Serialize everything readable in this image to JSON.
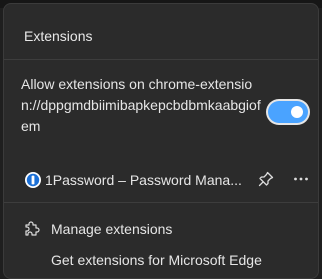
{
  "header": {
    "title": "Extensions"
  },
  "site_access": {
    "label": "Allow extensions on chrome-extension://dppgmdbiimibapkepcbdbmkaabgiofem",
    "enabled": true
  },
  "extensions": [
    {
      "name": "1Password – Password Mana...",
      "icon": "1password-icon"
    }
  ],
  "footer": {
    "manage_label": "Manage extensions",
    "get_label": "Get extensions for Microsoft Edge"
  },
  "colors": {
    "accent": "#4aa3ff",
    "background": "#2b2b2b"
  }
}
